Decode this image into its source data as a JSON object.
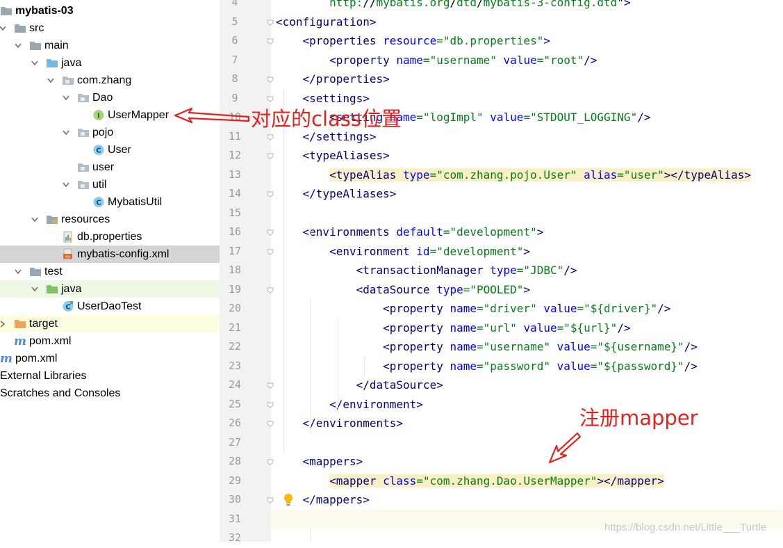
{
  "project_tree": {
    "items": [
      {
        "label": "mybatis-03",
        "icon": "folder-icon",
        "expanded": true,
        "bold": true
      },
      {
        "label": "src",
        "icon": "folder-icon",
        "expanded": true
      },
      {
        "label": "main",
        "icon": "folder-icon",
        "expanded": true
      },
      {
        "label": "java",
        "icon": "source-folder-icon",
        "expanded": true
      },
      {
        "label": "com.zhang",
        "icon": "package-icon",
        "expanded": true
      },
      {
        "label": "Dao",
        "icon": "package-icon",
        "expanded": true
      },
      {
        "label": "UserMapper",
        "icon": "interface-icon",
        "badge": "I"
      },
      {
        "label": "pojo",
        "icon": "package-icon",
        "expanded": true
      },
      {
        "label": "User",
        "icon": "class-icon",
        "badge": "C"
      },
      {
        "label": "user",
        "icon": "package-icon"
      },
      {
        "label": "util",
        "icon": "package-icon",
        "expanded": true
      },
      {
        "label": "MybatisUtil",
        "icon": "class-icon",
        "badge": "C"
      },
      {
        "label": "resources",
        "icon": "resources-folder-icon",
        "expanded": true
      },
      {
        "label": "db.properties",
        "icon": "properties-file-icon"
      },
      {
        "label": "mybatis-config.xml",
        "icon": "xml-file-icon",
        "selected": true
      },
      {
        "label": "test",
        "icon": "folder-icon",
        "expanded": true
      },
      {
        "label": "java",
        "icon": "test-source-folder-icon",
        "expanded": true
      },
      {
        "label": "UserDaoTest",
        "icon": "test-class-icon",
        "badge": "C"
      },
      {
        "label": "target",
        "icon": "excluded-folder-icon",
        "expanded": false
      },
      {
        "label": "pom.xml",
        "icon": "maven-icon",
        "badge": "m"
      },
      {
        "label": "pom.xml",
        "icon": "maven-icon",
        "badge": "m"
      },
      {
        "label": "External Libraries",
        "icon": "library-icon"
      },
      {
        "label": "Scratches and Consoles",
        "icon": "scratches-icon"
      }
    ]
  },
  "editor": {
    "lines": [
      {
        "n": "4",
        "code": "        http://mybatis.org/dtd/mybatis-3-config.dtd\">"
      },
      {
        "n": "5",
        "code": "<configuration>"
      },
      {
        "n": "6",
        "code": "    <properties resource=\"db.properties\">"
      },
      {
        "n": "7",
        "code": "        <property name=\"username\" value=\"root\"/>"
      },
      {
        "n": "8",
        "code": "    </properties>"
      },
      {
        "n": "9",
        "code": "    <settings>"
      },
      {
        "n": "10",
        "code": "        <setting name=\"logImpl\" value=\"STDOUT_LOGGING\"/>"
      },
      {
        "n": "11",
        "code": "    </settings>"
      },
      {
        "n": "12",
        "code": "    <typeAliases>"
      },
      {
        "n": "13",
        "code": "        <typeAlias type=\"com.zhang.pojo.User\" alias=\"user\"></typeAlias>"
      },
      {
        "n": "14",
        "code": "    </typeAliases>"
      },
      {
        "n": "15",
        "code": ""
      },
      {
        "n": "16",
        "code": "    <environments default=\"development\">"
      },
      {
        "n": "17",
        "code": "        <environment id=\"development\">"
      },
      {
        "n": "18",
        "code": "            <transactionManager type=\"JDBC\"/>"
      },
      {
        "n": "19",
        "code": "            <dataSource type=\"POOLED\">"
      },
      {
        "n": "20",
        "code": "                <property name=\"driver\" value=\"${driver}\"/>"
      },
      {
        "n": "21",
        "code": "                <property name=\"url\" value=\"${url}\"/>"
      },
      {
        "n": "22",
        "code": "                <property name=\"username\" value=\"${username}\"/>"
      },
      {
        "n": "23",
        "code": "                <property name=\"password\" value=\"${password}\"/>"
      },
      {
        "n": "24",
        "code": "            </dataSource>"
      },
      {
        "n": "25",
        "code": "        </environment>"
      },
      {
        "n": "26",
        "code": "    </environments>"
      },
      {
        "n": "27",
        "code": ""
      },
      {
        "n": "28",
        "code": "    <mappers>"
      },
      {
        "n": "29",
        "code": "        <mapper class=\"com.zhang.Dao.UserMapper\"></mapper>"
      },
      {
        "n": "30",
        "code": "    </mappers>"
      },
      {
        "n": "31",
        "code": ""
      },
      {
        "n": "32",
        "code": ""
      }
    ]
  },
  "annotations": {
    "class_location": "对应的class位置",
    "register_mapper": "注册mapper",
    "color": "#e8201c"
  },
  "watermark": "https://blog.csdn.net/Little___Turtle",
  "colors": {
    "tag": "#000080",
    "attribute": "#0000ff",
    "value": "#067d17",
    "highlight": "#f9f0c6",
    "selection": "#d5d5d5"
  }
}
